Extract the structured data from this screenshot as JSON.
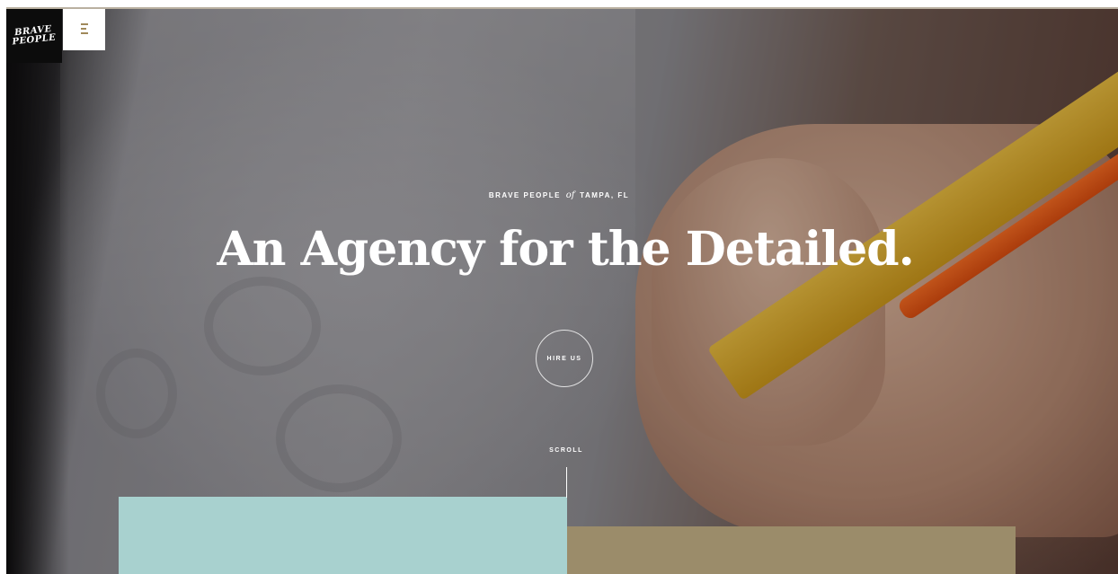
{
  "brand": {
    "logo_text_line1": "BRAVE",
    "logo_text_line2": "PEOPLE"
  },
  "menu": {
    "icon": "hamburger-menu-icon",
    "icon_color": "#a0895a"
  },
  "hero": {
    "eyebrow_left": "BRAVE PEOPLE",
    "eyebrow_of": "of",
    "eyebrow_right": "TAMPA, FL",
    "headline": "An Agency for the Detailed.",
    "cta_label": "HIRE US",
    "scroll_label": "SCROLL"
  },
  "colors": {
    "teal_block": "#a8d1cf",
    "tan_block": "#9b8c6a",
    "logo_bg": "#0c0c0c"
  }
}
